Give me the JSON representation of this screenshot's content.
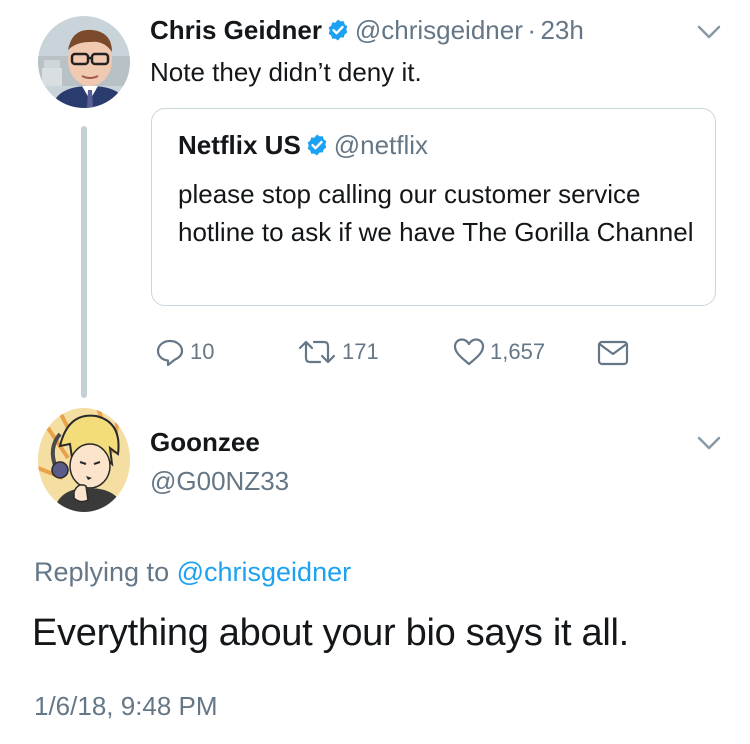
{
  "tweet": {
    "author_name": "Chris Geidner",
    "author_handle": "@chrisgeidner",
    "separator": "·",
    "timestamp": "23h",
    "text": "Note they didn’t deny it.",
    "quoted": {
      "author_name": "Netflix US",
      "author_handle": "@netflix",
      "text": "please stop calling our customer service hotline to ask if we have The Gorilla Channel"
    },
    "actions": {
      "replies": "10",
      "retweets": "171",
      "likes": "1,657"
    }
  },
  "reply": {
    "author_name": "Goonzee",
    "author_handle": "@G00NZ33",
    "replying_prefix": "Replying to",
    "replying_to": "@chrisgeidner",
    "text": "Everything about your bio says it all.",
    "timestamp": "1/6/18, 9:48 PM"
  },
  "colors": {
    "link": "#1da1f2",
    "secondary": "#657786",
    "verified": "#1da1f2",
    "thread_line": "#c4cfd6"
  },
  "icons": [
    "verified-badge-icon",
    "chevron-down-icon",
    "reply-icon",
    "retweet-icon",
    "like-icon",
    "direct-message-icon"
  ]
}
